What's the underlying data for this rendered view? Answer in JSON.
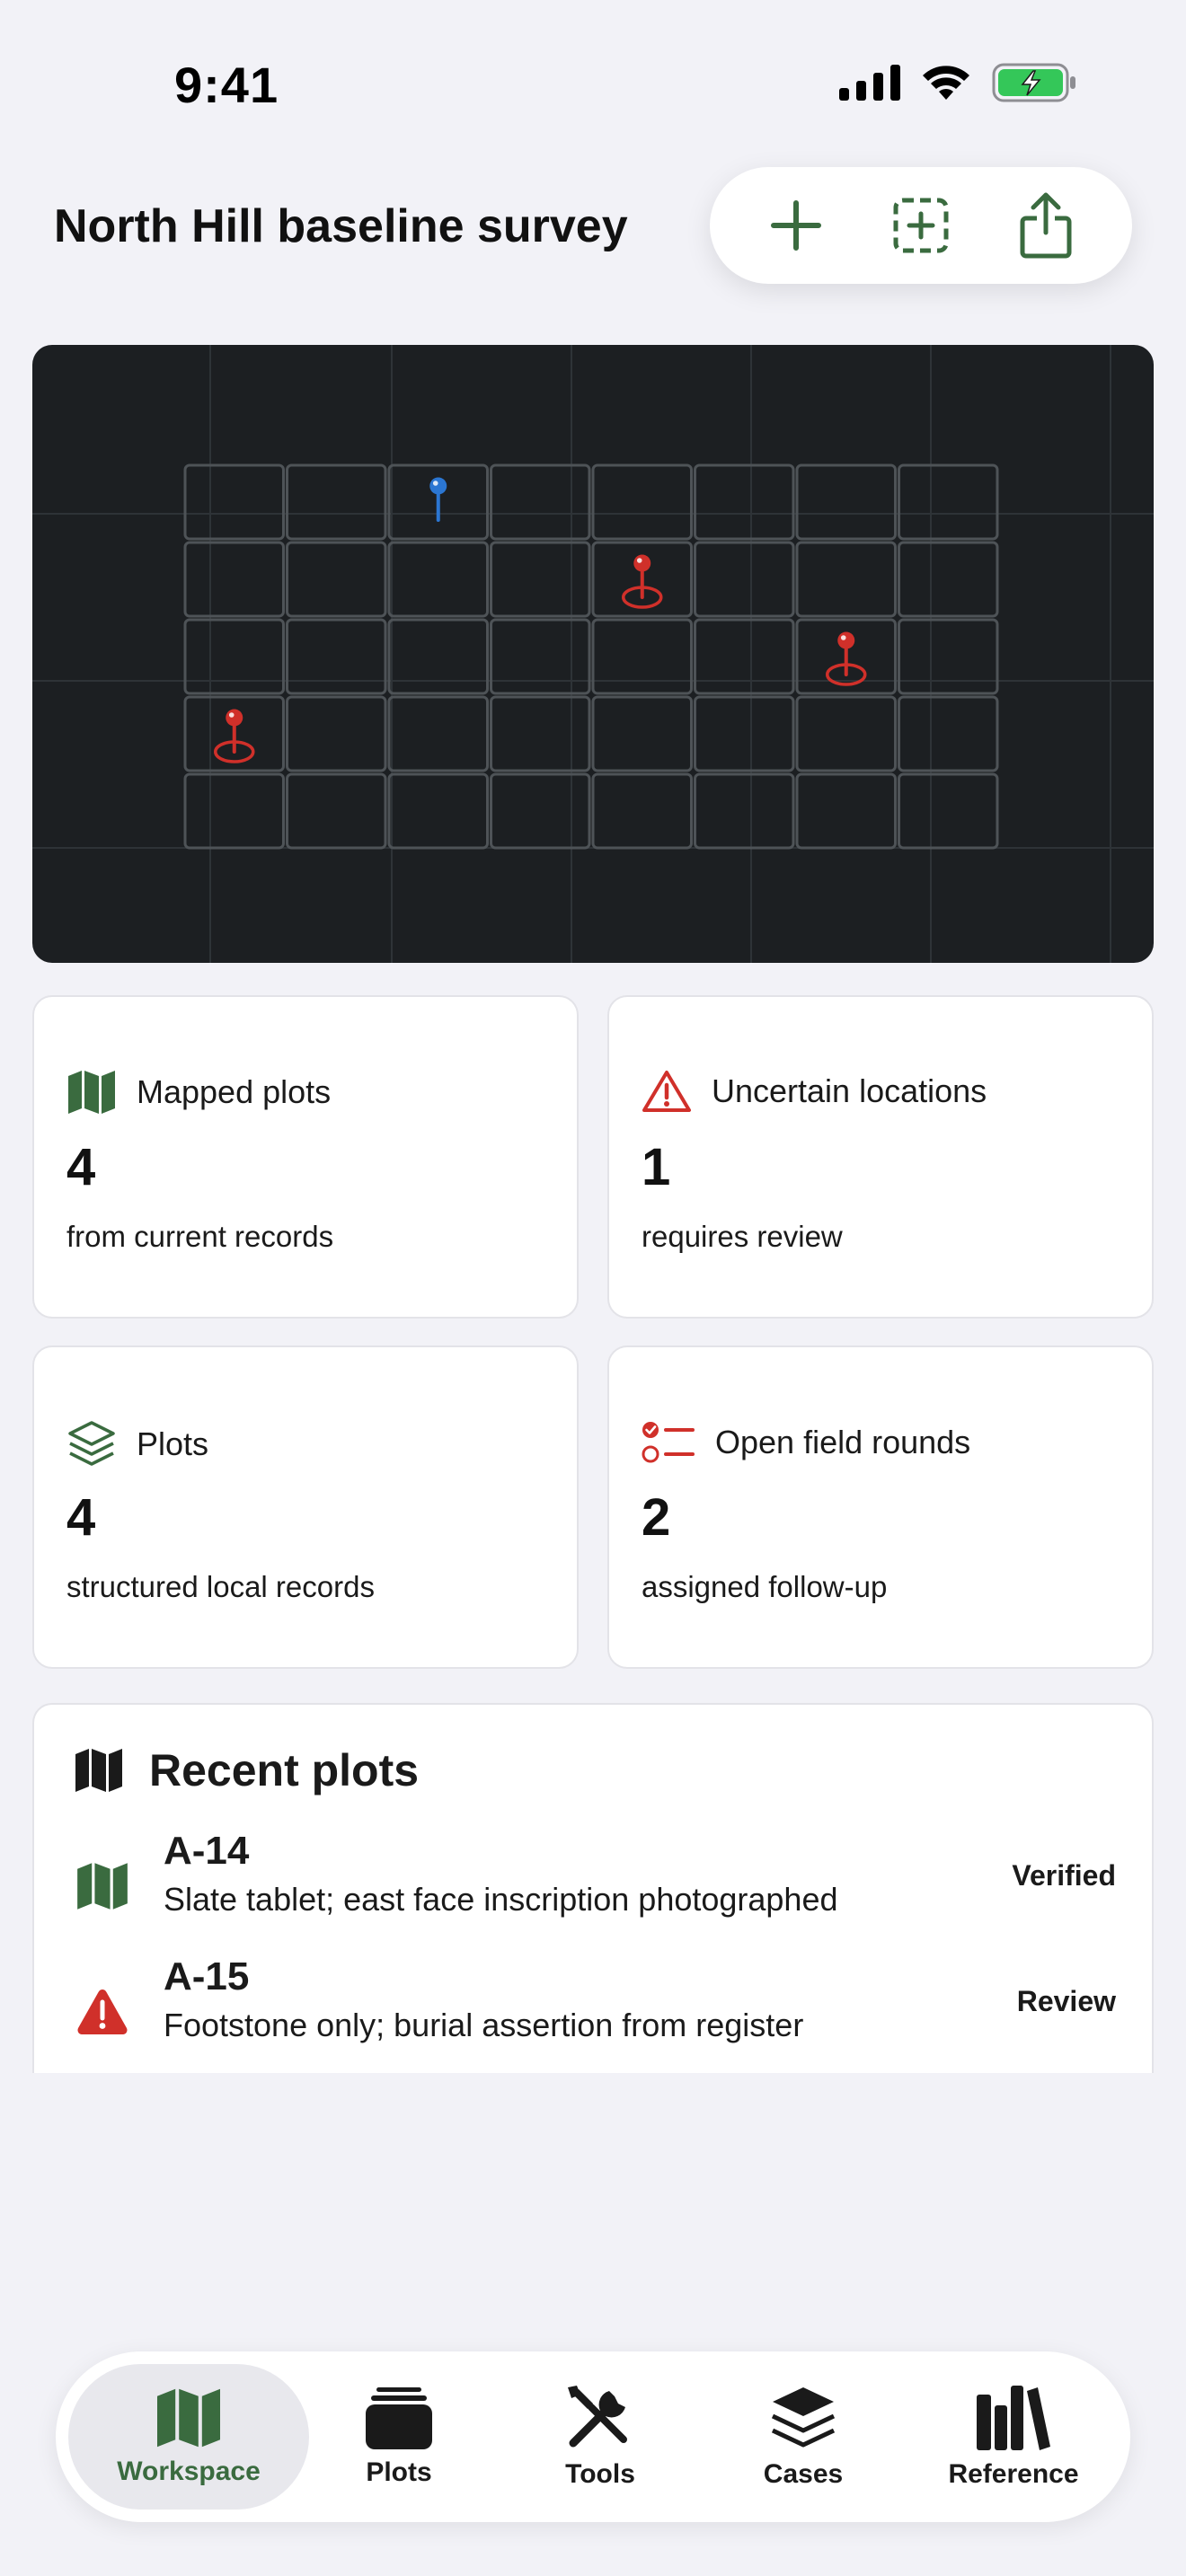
{
  "status_bar": {
    "time": "9:41",
    "icons": [
      "cellular-signal-icon",
      "wifi-icon",
      "battery-charging-icon"
    ]
  },
  "header": {
    "title": "North Hill baseline survey",
    "actions": [
      {
        "icon": "plus-icon",
        "name": "add-button"
      },
      {
        "icon": "dashed-plus-square-icon",
        "name": "new-selection-button"
      },
      {
        "icon": "share-icon",
        "name": "share-button"
      }
    ]
  },
  "map": {
    "grid": {
      "rows": 5,
      "cols": 8
    },
    "markers": [
      {
        "row": 1,
        "col": 3,
        "status": "verified",
        "color": "#2b76d2"
      },
      {
        "row": 2,
        "col": 5,
        "status": "uncertain",
        "color": "#d0302a"
      },
      {
        "row": 3,
        "col": 7,
        "status": "uncertain",
        "color": "#d0302a"
      },
      {
        "row": 4,
        "col": 1,
        "status": "uncertain",
        "color": "#d0302a"
      }
    ]
  },
  "stats": [
    {
      "icon": "map-icon",
      "label": "Mapped plots",
      "value": "4",
      "sub": "from current records",
      "color": "#3a6b3f"
    },
    {
      "icon": "warning-triangle-icon",
      "label": "Uncertain locations",
      "value": "1",
      "sub": "requires review",
      "color": "#d0302a"
    },
    {
      "icon": "layers-icon",
      "label": "Plots",
      "value": "4",
      "sub": "structured local records",
      "color": "#3a6b3f"
    },
    {
      "icon": "checklist-icon",
      "label": "Open field rounds",
      "value": "2",
      "sub": "assigned follow-up",
      "color": "#d0302a"
    }
  ],
  "recent": {
    "title": "Recent plots",
    "items": [
      {
        "id": "A-14",
        "desc": "Slate tablet; east face inscription photographed",
        "status": "Verified",
        "icon": "map-icon"
      },
      {
        "id": "A-15",
        "desc": "Footstone only; burial assertion from register",
        "status": "Review",
        "icon": "warning-triangle-filled-icon"
      }
    ]
  },
  "tabs": [
    {
      "label": "Workspace",
      "icon": "map-icon",
      "active": true
    },
    {
      "label": "Plots",
      "icon": "stacked-cards-icon",
      "active": false
    },
    {
      "label": "Tools",
      "icon": "tools-icon",
      "active": false
    },
    {
      "label": "Cases",
      "icon": "layers-icon",
      "active": false
    },
    {
      "label": "Reference",
      "icon": "books-icon",
      "active": false
    }
  ],
  "colors": {
    "accent_green": "#3a6b3f",
    "alert_red": "#d0302a",
    "marker_blue": "#2b76d2",
    "map_bg": "#1c1f22"
  }
}
